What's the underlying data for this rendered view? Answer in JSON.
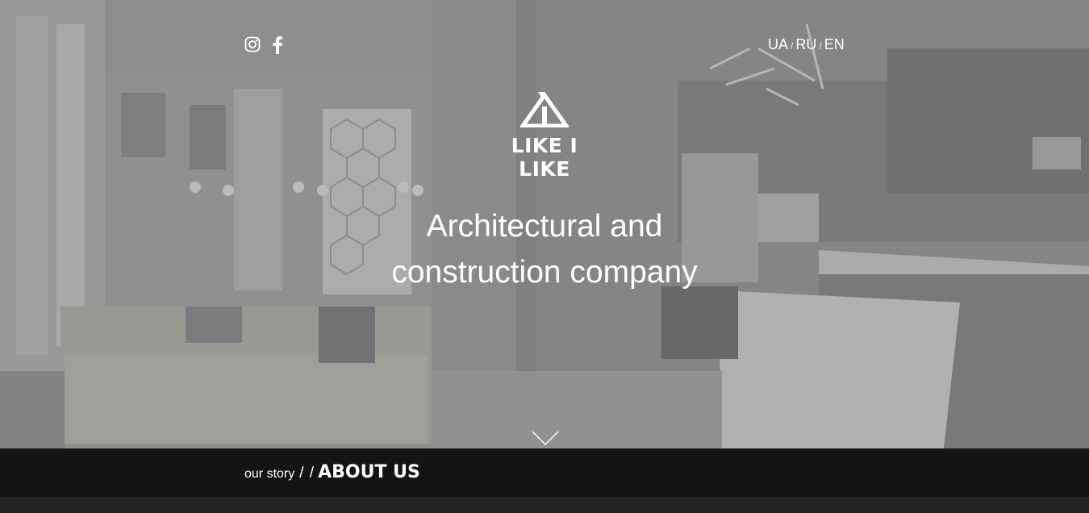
{
  "header": {
    "social": [
      {
        "icon": "instagram-icon"
      },
      {
        "icon": "facebook-icon"
      }
    ],
    "languages": [
      "UA",
      "RU",
      "EN"
    ],
    "language_separator": "/"
  },
  "logo": {
    "text": "LIKE I LIKE"
  },
  "hero": {
    "headline_line1": "Architectural and",
    "headline_line2": "construction company"
  },
  "section_bar": {
    "subtitle": "our story",
    "separator": "/ /",
    "title": "ABOUT US"
  },
  "colors": {
    "text": "#ffffff",
    "bar_background": "#141414",
    "hero_tint": "#8d8d8f"
  }
}
